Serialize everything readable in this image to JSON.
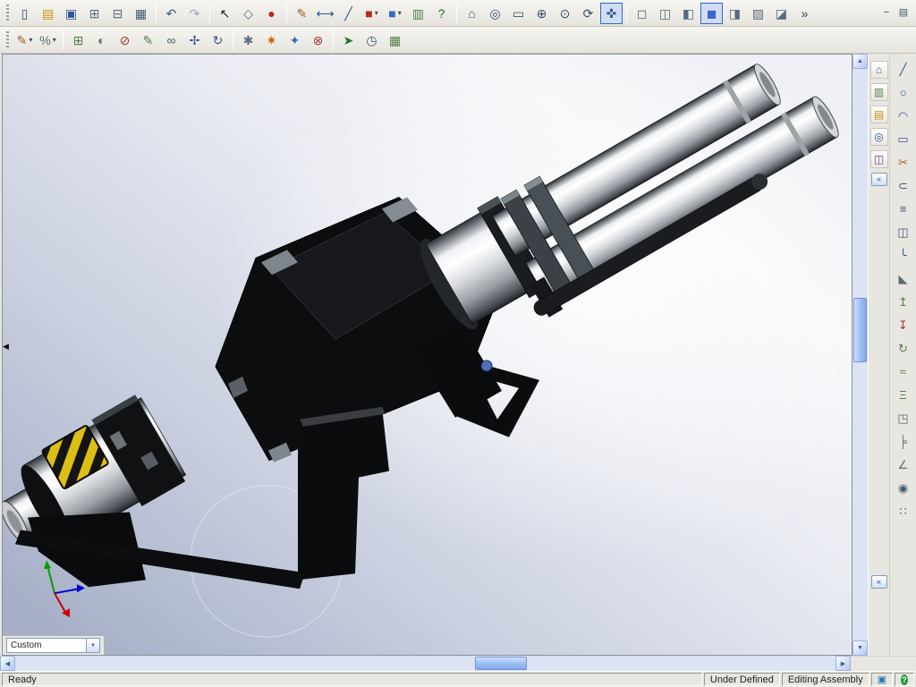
{
  "toolbar_main": {
    "buttons": [
      {
        "name": "new-document",
        "glyph": "▯",
        "color": "#38506e"
      },
      {
        "name": "open-document",
        "glyph": "▤",
        "color": "#c8920a"
      },
      {
        "name": "save",
        "glyph": "▣",
        "color": "#2f5496"
      },
      {
        "name": "make-drawing",
        "glyph": "⊞",
        "color": "#5a6b7d"
      },
      {
        "name": "make-assembly",
        "glyph": "⊟",
        "color": "#5a6b7d"
      },
      {
        "name": "print",
        "glyph": "▦",
        "color": "#41586e"
      },
      {
        "sep": true
      },
      {
        "name": "undo",
        "glyph": "↶",
        "color": "#2f5496"
      },
      {
        "name": "redo",
        "glyph": "↷",
        "color": "#9aa4b5",
        "disabled": true
      },
      {
        "sep": true
      },
      {
        "name": "select",
        "glyph": "↖",
        "color": "#1d1d1d"
      },
      {
        "name": "select-other",
        "glyph": "◇",
        "color": "#5a6b7d"
      },
      {
        "name": "record-macro",
        "glyph": "●",
        "color": "#c22222"
      },
      {
        "sep": true
      },
      {
        "name": "sketch",
        "glyph": "✎",
        "color": "#a3621a"
      },
      {
        "name": "dimension",
        "glyph": "⟷",
        "color": "#2f5496"
      },
      {
        "name": "sketch-line",
        "glyph": "╱",
        "color": "#2f5496"
      },
      {
        "name": "toolbox",
        "glyph": "■",
        "color": "#b42a1e",
        "dropdown": true
      },
      {
        "name": "view-settings",
        "glyph": "■",
        "color": "#3668c8",
        "dropdown": true
      },
      {
        "name": "design-checker",
        "glyph": "▥",
        "color": "#52804a"
      },
      {
        "name": "help",
        "glyph": "?",
        "color": "#0a7a1e"
      },
      {
        "sep": true
      },
      {
        "name": "view-orientation",
        "glyph": "⌂",
        "color": "#38506e"
      },
      {
        "name": "zoom-to-fit",
        "glyph": "◎",
        "color": "#38506e"
      },
      {
        "name": "zoom-to-area",
        "glyph": "▭",
        "color": "#38506e"
      },
      {
        "name": "zoom-in-out",
        "glyph": "⊕",
        "color": "#38506e"
      },
      {
        "name": "zoom-to-selection",
        "glyph": "⊙",
        "color": "#38506e"
      },
      {
        "name": "rotate-view",
        "glyph": "⟳",
        "color": "#38506e"
      },
      {
        "name": "pan",
        "glyph": "✜",
        "color": "#2f5496",
        "pressed": true
      },
      {
        "sep": true
      },
      {
        "name": "wireframe",
        "glyph": "◻",
        "color": "#5a6b7d"
      },
      {
        "name": "hidden-lines-visible",
        "glyph": "◫",
        "color": "#5a6b7d"
      },
      {
        "name": "hidden-lines-removed",
        "glyph": "◧",
        "color": "#5a6b7d"
      },
      {
        "name": "shaded",
        "glyph": "◼",
        "color": "#3668c8",
        "pressed": true
      },
      {
        "name": "shadows",
        "glyph": "◨",
        "color": "#5a6b7d"
      },
      {
        "name": "perspective",
        "glyph": "▨",
        "color": "#5a6b7d"
      },
      {
        "name": "section-view",
        "glyph": "◪",
        "color": "#5a6b7d"
      },
      {
        "name": "more-tools",
        "glyph": "»",
        "color": "#33435c"
      }
    ],
    "corner_buttons": [
      {
        "name": "collapse-toolbar",
        "glyph": "−",
        "color": "#33435c"
      },
      {
        "name": "customize-toolbar",
        "glyph": "▤",
        "color": "#41586e"
      }
    ]
  },
  "toolbar_assembly": {
    "buttons": [
      {
        "name": "sketch-tool",
        "glyph": "✎",
        "color": "#a3621a",
        "dropdown": true
      },
      {
        "name": "measure-tool",
        "glyph": "%",
        "color": "#5a6b7d",
        "dropdown": true
      },
      {
        "sep": true
      },
      {
        "name": "insert-component",
        "glyph": "⊞",
        "color": "#52804a"
      },
      {
        "name": "hide-show-component",
        "glyph": "◐",
        "color": "#5a6b7d"
      },
      {
        "name": "change-suppression",
        "glyph": "⊘",
        "color": "#a23a2e"
      },
      {
        "name": "edit-component",
        "glyph": "✎",
        "color": "#52804a"
      },
      {
        "name": "mate",
        "glyph": "∞",
        "color": "#41586e"
      },
      {
        "name": "move-component",
        "glyph": "✢",
        "color": "#2f5496"
      },
      {
        "name": "rotate-component",
        "glyph": "↻",
        "color": "#2f5496"
      },
      {
        "sep": true
      },
      {
        "name": "smart-fasteners",
        "glyph": "✱",
        "color": "#5a6b7d"
      },
      {
        "name": "exploded-view",
        "glyph": "✷",
        "color": "#c2690e"
      },
      {
        "name": "explode-line-sketch",
        "glyph": "✦",
        "color": "#3668c8"
      },
      {
        "name": "interference-detection",
        "glyph": "⊗",
        "color": "#a23a2e"
      },
      {
        "sep": true
      },
      {
        "name": "simulation",
        "glyph": "➤",
        "color": "#1b7a2a"
      },
      {
        "name": "motion-study",
        "glyph": "◷",
        "color": "#41586e"
      },
      {
        "name": "design-table",
        "glyph": "▦",
        "color": "#52804a"
      }
    ]
  },
  "task_pane": {
    "tabs": [
      {
        "name": "home",
        "glyph": "⌂",
        "color": "#41586e"
      },
      {
        "name": "design-library",
        "glyph": "▥",
        "color": "#52804a"
      },
      {
        "name": "file-explorer",
        "glyph": "▤",
        "color": "#c8920a"
      },
      {
        "name": "search-results",
        "glyph": "◎",
        "color": "#2f5496"
      },
      {
        "name": "view-palette",
        "glyph": "◫",
        "color": "#7a3a8e"
      }
    ],
    "collapse_top_glyph": "«",
    "collapse_bottom_glyph": "«"
  },
  "right_toolbar": {
    "buttons": [
      {
        "name": "sketch-line-tool",
        "glyph": "╱",
        "color": "#2f5496"
      },
      {
        "name": "sketch-circle-tool",
        "glyph": "○",
        "color": "#2f5496"
      },
      {
        "name": "sketch-arc-tool",
        "glyph": "◠",
        "color": "#2f5496"
      },
      {
        "name": "sketch-rectangle-tool",
        "glyph": "▭",
        "color": "#2f5496"
      },
      {
        "name": "trim-entities",
        "glyph": "✂",
        "color": "#a3621a"
      },
      {
        "name": "convert-entities",
        "glyph": "⊂",
        "color": "#41586e"
      },
      {
        "name": "offset-entities",
        "glyph": "≡",
        "color": "#41586e"
      },
      {
        "name": "mirror-entities",
        "glyph": "◫",
        "color": "#41586e"
      },
      {
        "name": "fillet-tool",
        "glyph": "╰",
        "color": "#2f5496"
      },
      {
        "name": "chamfer-tool",
        "glyph": "◣",
        "color": "#5a6b7d"
      },
      {
        "name": "extrude-boss",
        "glyph": "↥",
        "color": "#52804a"
      },
      {
        "name": "extrude-cut",
        "glyph": "↧",
        "color": "#a23a2e"
      },
      {
        "name": "revolve-boss",
        "glyph": "↻",
        "color": "#52804a"
      },
      {
        "name": "sweep",
        "glyph": "≈",
        "color": "#52804a"
      },
      {
        "name": "loft",
        "glyph": "Ξ",
        "color": "#52804a"
      },
      {
        "name": "shell-tool",
        "glyph": "◳",
        "color": "#5a6b7d"
      },
      {
        "name": "rib-tool",
        "glyph": "╞",
        "color": "#5a6b7d"
      },
      {
        "name": "draft-tool",
        "glyph": "∠",
        "color": "#5a6b7d"
      },
      {
        "name": "hole-wizard",
        "glyph": "◉",
        "color": "#41586e"
      },
      {
        "name": "linear-pattern",
        "glyph": "∷",
        "color": "#41586e"
      }
    ]
  },
  "viewport": {
    "config_selector": {
      "value": "Custom",
      "dropdown_glyph": "▼"
    },
    "splitter_glyph": "◀",
    "triad_colors": {
      "x_axis": "#cc0000",
      "y_axis": "#00a000",
      "z_axis": "#0000cc"
    },
    "model_colors": {
      "body": "#0c0d0f",
      "chrome_highlight": "#ffffff",
      "chrome_shadow": "#24282c",
      "hazard_yellow": "#dcbe14",
      "bolt_blue": "#4f6fbe"
    }
  },
  "scrollbars": {
    "up": "▲",
    "down": "▼",
    "left": "◀",
    "right": "▶"
  },
  "status_bar": {
    "message": "Ready",
    "constraint_status": "Under Defined",
    "mode": "Editing Assembly",
    "mini_icon_glyph": "▣",
    "help_glyph": "?"
  }
}
